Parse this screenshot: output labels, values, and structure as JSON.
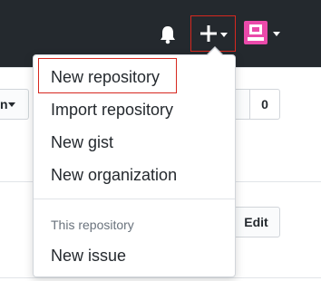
{
  "header": {
    "notifications_icon": "bell-icon",
    "create_icon": "plus-icon",
    "avatar_icon": "user-avatar-icon"
  },
  "background": {
    "left_button_label": "n",
    "star_count": "0",
    "edit_label": "Edit"
  },
  "dropdown": {
    "items": [
      "New repository",
      "Import repository",
      "New gist",
      "New organization"
    ],
    "section_header": "This repository",
    "section_items": [
      "New issue"
    ]
  },
  "colors": {
    "header_bg": "#24292e",
    "highlight_border": "#d7281f",
    "avatar_pink": "#ea4aaa",
    "text_dark": "#24292e",
    "text_muted": "#6a737d"
  }
}
